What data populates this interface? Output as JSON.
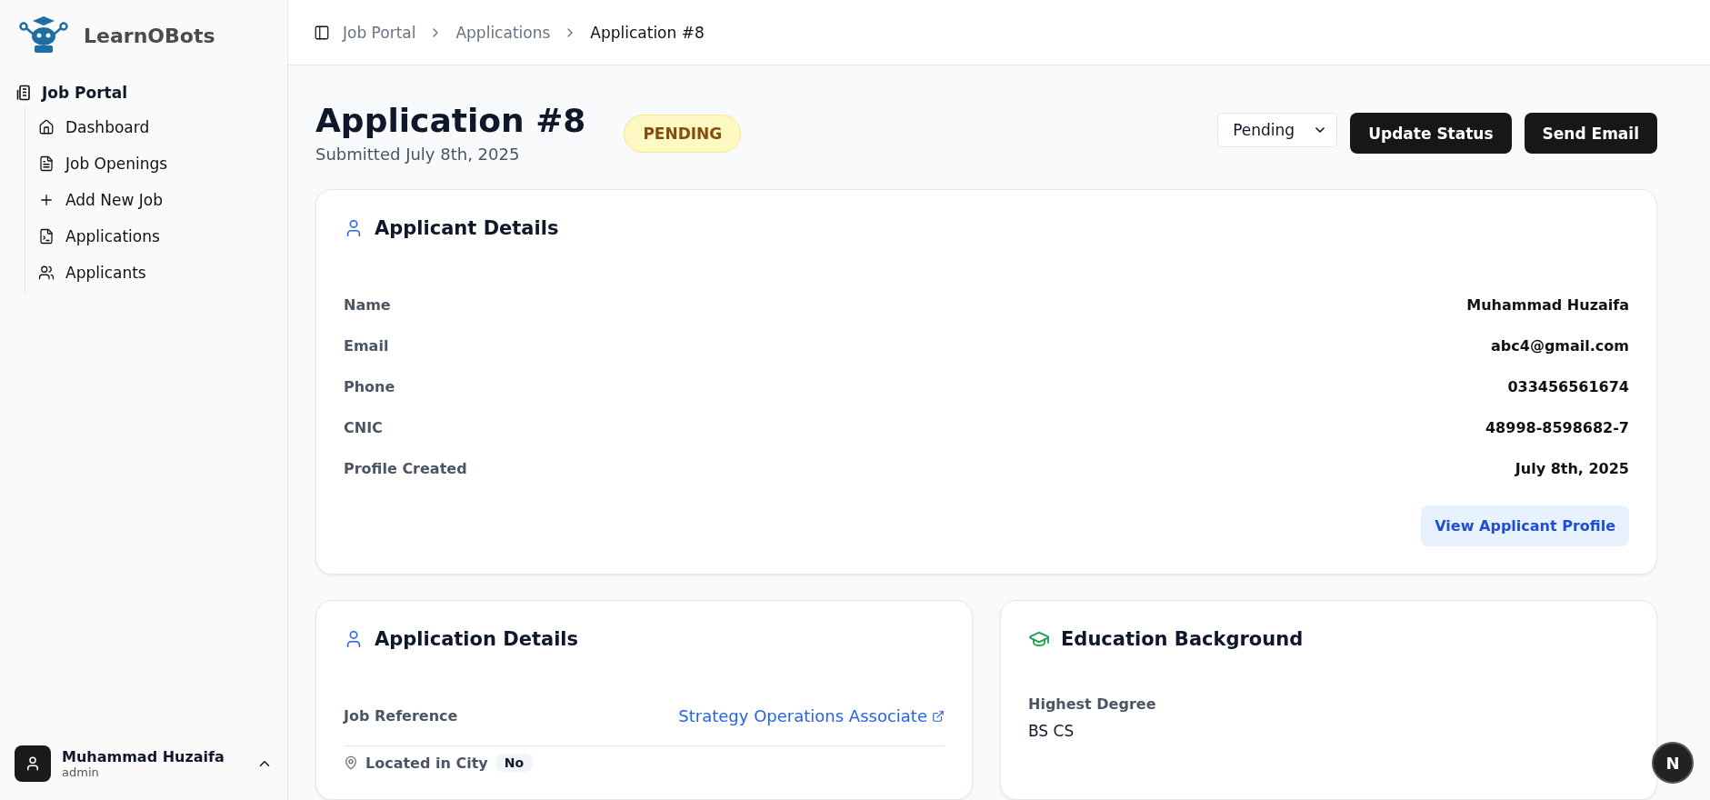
{
  "sidebar": {
    "brand": "LearnOBots",
    "group": {
      "label": "Job Portal",
      "items": [
        {
          "label": "Dashboard"
        },
        {
          "label": "Job Openings"
        },
        {
          "label": "Add New Job"
        },
        {
          "label": "Applications"
        },
        {
          "label": "Applicants"
        }
      ]
    },
    "user": {
      "name": "Muhammad Huzaifa",
      "role": "admin"
    }
  },
  "breadcrumb": [
    "Job Portal",
    "Applications",
    "Application #8"
  ],
  "header": {
    "title": "Application #8",
    "submitted": "Submitted July 8th, 2025",
    "status_badge": "PENDING",
    "status_select": "Pending",
    "buttons": [
      "Update Status",
      "Send Email"
    ]
  },
  "applicant_details": {
    "title": "Applicant Details",
    "fields": [
      {
        "label": "Name",
        "value": "Muhammad Huzaifa"
      },
      {
        "label": "Email",
        "value": "abc4@gmail.com"
      },
      {
        "label": "Phone",
        "value": "033456561674"
      },
      {
        "label": "CNIC",
        "value": "48998-8598682-7"
      },
      {
        "label": "Profile Created",
        "value": "July 8th, 2025"
      }
    ],
    "profile_button": "View Applicant Profile"
  },
  "application_details": {
    "title": "Application Details",
    "job_reference": {
      "label": "Job Reference",
      "value": "Strategy Operations Associate"
    },
    "located_in_city": {
      "label": "Located in City",
      "value": "No"
    }
  },
  "education": {
    "title": "Education Background",
    "highest_degree": {
      "label": "Highest Degree",
      "value": "BS CS"
    }
  },
  "dev_badge": "N"
}
